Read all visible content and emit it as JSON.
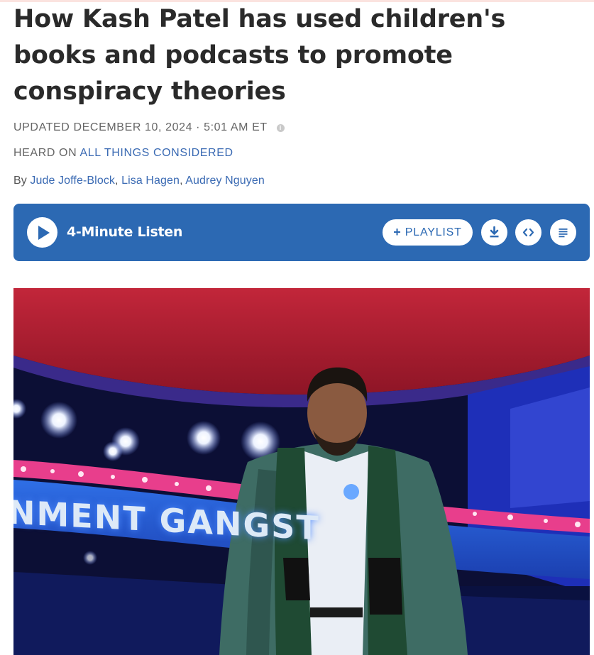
{
  "article": {
    "title": "How Kash Patel has used children's books and podcasts to promote conspiracy theories",
    "updated": "UPDATED DECEMBER 10, 2024 · 5:01 AM ET",
    "heard_prefix": "HEARD ON",
    "heard_program": "ALL THINGS CONSIDERED",
    "byline_prefix": "By",
    "authors": [
      "Jude Joffe-Block",
      "Lisa Hagen",
      "Audrey Nguyen"
    ]
  },
  "player": {
    "listen_label": "4-Minute Listen",
    "playlist_label": "PLAYLIST",
    "accent": "#2c69b3"
  },
  "photo": {
    "sign_text": "NMENT GANGST"
  },
  "icons": {
    "play": "play-icon",
    "info": "info-icon",
    "plus": "plus-icon",
    "download": "download-icon",
    "embed": "embed-code-icon",
    "transcript": "transcript-icon"
  }
}
